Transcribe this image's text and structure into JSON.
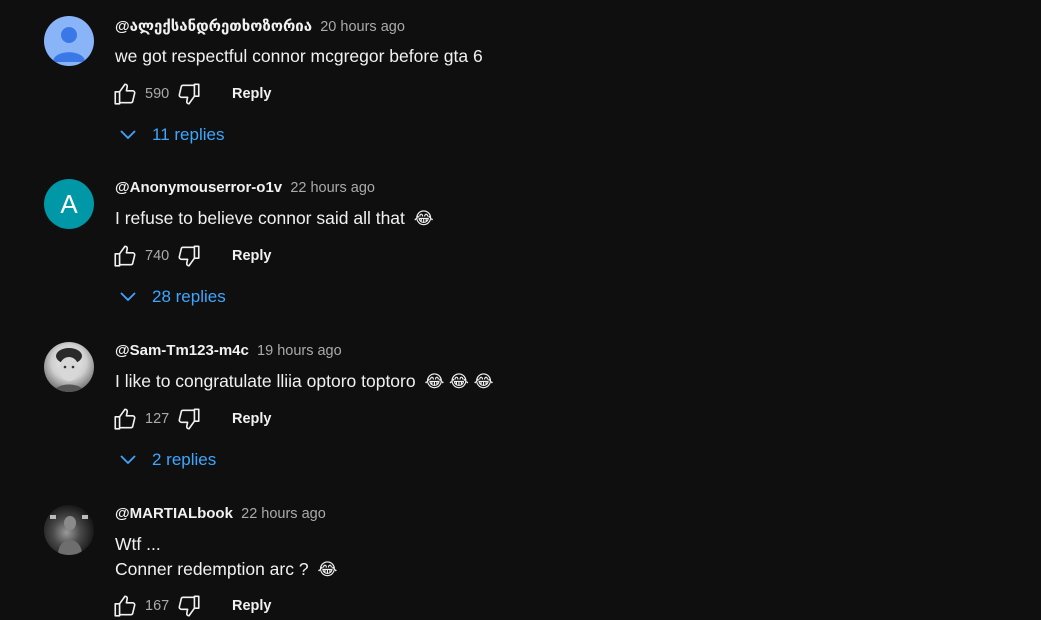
{
  "comments": [
    {
      "author": "@ალექსანდრეთხოზორია",
      "time": "20 hours ago",
      "lines": [
        "we got respectful connor mcgregor before gta 6"
      ],
      "emoji": "",
      "likes": "590",
      "reply_label": "Reply",
      "replies_label": "11 replies",
      "avatar_type": "default"
    },
    {
      "author": "@Anonymouserror-o1v",
      "time": "22 hours ago",
      "lines": [
        "I refuse to believe connor said all that"
      ],
      "emoji": "😂",
      "likes": "740",
      "reply_label": "Reply",
      "replies_label": "28 replies",
      "avatar_type": "letter",
      "avatar_letter": "A"
    },
    {
      "author": "@Sam-Tm123-m4c",
      "time": "19 hours ago",
      "lines": [
        "I like to congratulate llіia optoro toptoro"
      ],
      "emoji": "😂 😂 😂",
      "likes": "127",
      "reply_label": "Reply",
      "replies_label": "2 replies",
      "avatar_type": "photo"
    },
    {
      "author": "@MARTIALbook",
      "time": "22 hours ago",
      "lines": [
        "Wtf ...",
        "Conner redemption arc ?"
      ],
      "emoji": "😂",
      "likes": "167",
      "reply_label": "Reply",
      "avatar_type": "photo"
    }
  ],
  "colors": {
    "background": "#0f0f0f",
    "link": "#3ea6ff",
    "muted": "#aaaaaa",
    "avatar_letter_bg": "#0097a7"
  },
  "icons": {
    "like": "thumbs-up-icon",
    "dislike": "thumbs-down-icon",
    "expand": "chevron-down-icon"
  }
}
